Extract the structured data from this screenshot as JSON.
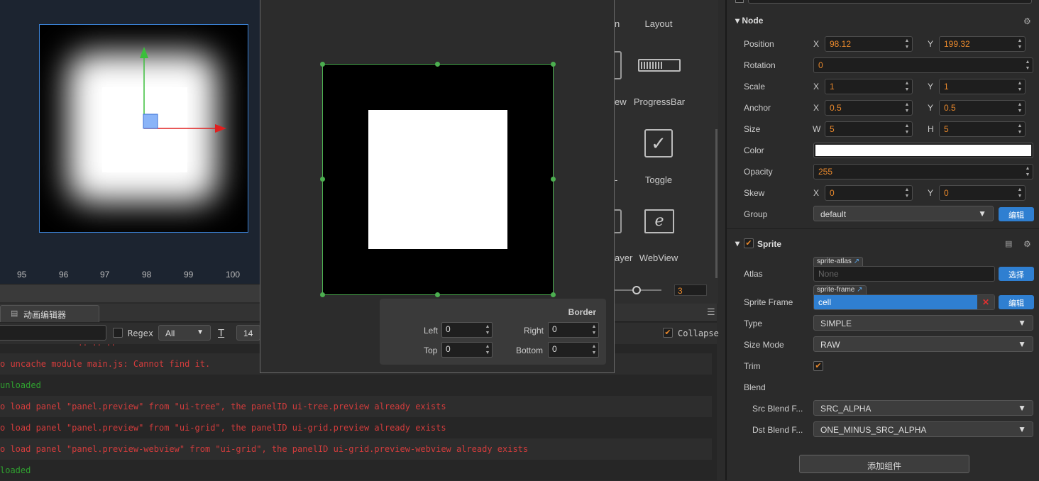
{
  "scene": {
    "ruler": [
      "95",
      "96",
      "97",
      "98",
      "99",
      "100"
    ]
  },
  "console": {
    "tab_label": "动画编辑器",
    "regex_label": "Regex",
    "filter_value": "All",
    "font_size": "14",
    "collapse_label": "Collapse",
    "logs": [
      {
        "text": "o uncache module main.js: Cannot find it.",
        "type": "err"
      },
      {
        "text": "unloaded",
        "type": "ok"
      },
      {
        "text": "o load panel \"panel.preview\" from \"ui-tree\", the panelID ui-tree.preview already exists",
        "type": "err"
      },
      {
        "text": "o load panel \"panel.preview\" from \"ui-grid\", the panelID ui-grid.preview already exists",
        "type": "err"
      },
      {
        "text": "o load panel \"panel.preview-webview\" from \"ui-grid\", the panelID ui-grid.preview-webview already exists",
        "type": "err"
      },
      {
        "text": "loaded",
        "type": "ok"
      }
    ]
  },
  "sprite_editor": {
    "border_title": "Border",
    "left_label": "Left",
    "left_value": "0",
    "right_label": "Right",
    "right_value": "0",
    "top_label": "Top",
    "top_value": "0",
    "bottom_label": "Bottom",
    "bottom_value": "0"
  },
  "widgets": {
    "layout": "Layout",
    "progressbar": "ProgressBar",
    "toggle": "Toggle",
    "webview": "WebView",
    "partial_1": "n",
    "partial_2": "ew",
    "partial_3": "ayer",
    "zoom_value": "3"
  },
  "inspector": {
    "node": {
      "title": "Node",
      "position_label": "Position",
      "pos_x": "98.12",
      "pos_y": "199.32",
      "rotation_label": "Rotation",
      "rotation": "0",
      "scale_label": "Scale",
      "scale_x": "1",
      "scale_y": "1",
      "anchor_label": "Anchor",
      "anchor_x": "0.5",
      "anchor_y": "0.5",
      "size_label": "Size",
      "size_w": "5",
      "size_h": "5",
      "color_label": "Color",
      "color_value": "#ffffff",
      "opacity_label": "Opacity",
      "opacity": "255",
      "skew_label": "Skew",
      "skew_x": "0",
      "skew_y": "0",
      "group_label": "Group",
      "group": "default",
      "edit_button": "编辑",
      "x": "X",
      "y": "Y",
      "w": "W",
      "h": "H"
    },
    "sprite": {
      "title": "Sprite",
      "atlas_label": "Atlas",
      "atlas_tag": "sprite-atlas",
      "atlas_value": "None",
      "select_button": "选择",
      "frame_label": "Sprite Frame",
      "frame_tag": "sprite-frame",
      "frame_value": "cell",
      "edit_button": "编辑",
      "type_label": "Type",
      "type": "SIMPLE",
      "size_mode_label": "Size Mode",
      "size_mode": "RAW",
      "trim_label": "Trim",
      "blend_label": "Blend",
      "src_label": "Src Blend F...",
      "src": "SRC_ALPHA",
      "dst_label": "Dst Blend F...",
      "dst": "ONE_MINUS_SRC_ALPHA"
    },
    "add_component": "添加组件"
  }
}
